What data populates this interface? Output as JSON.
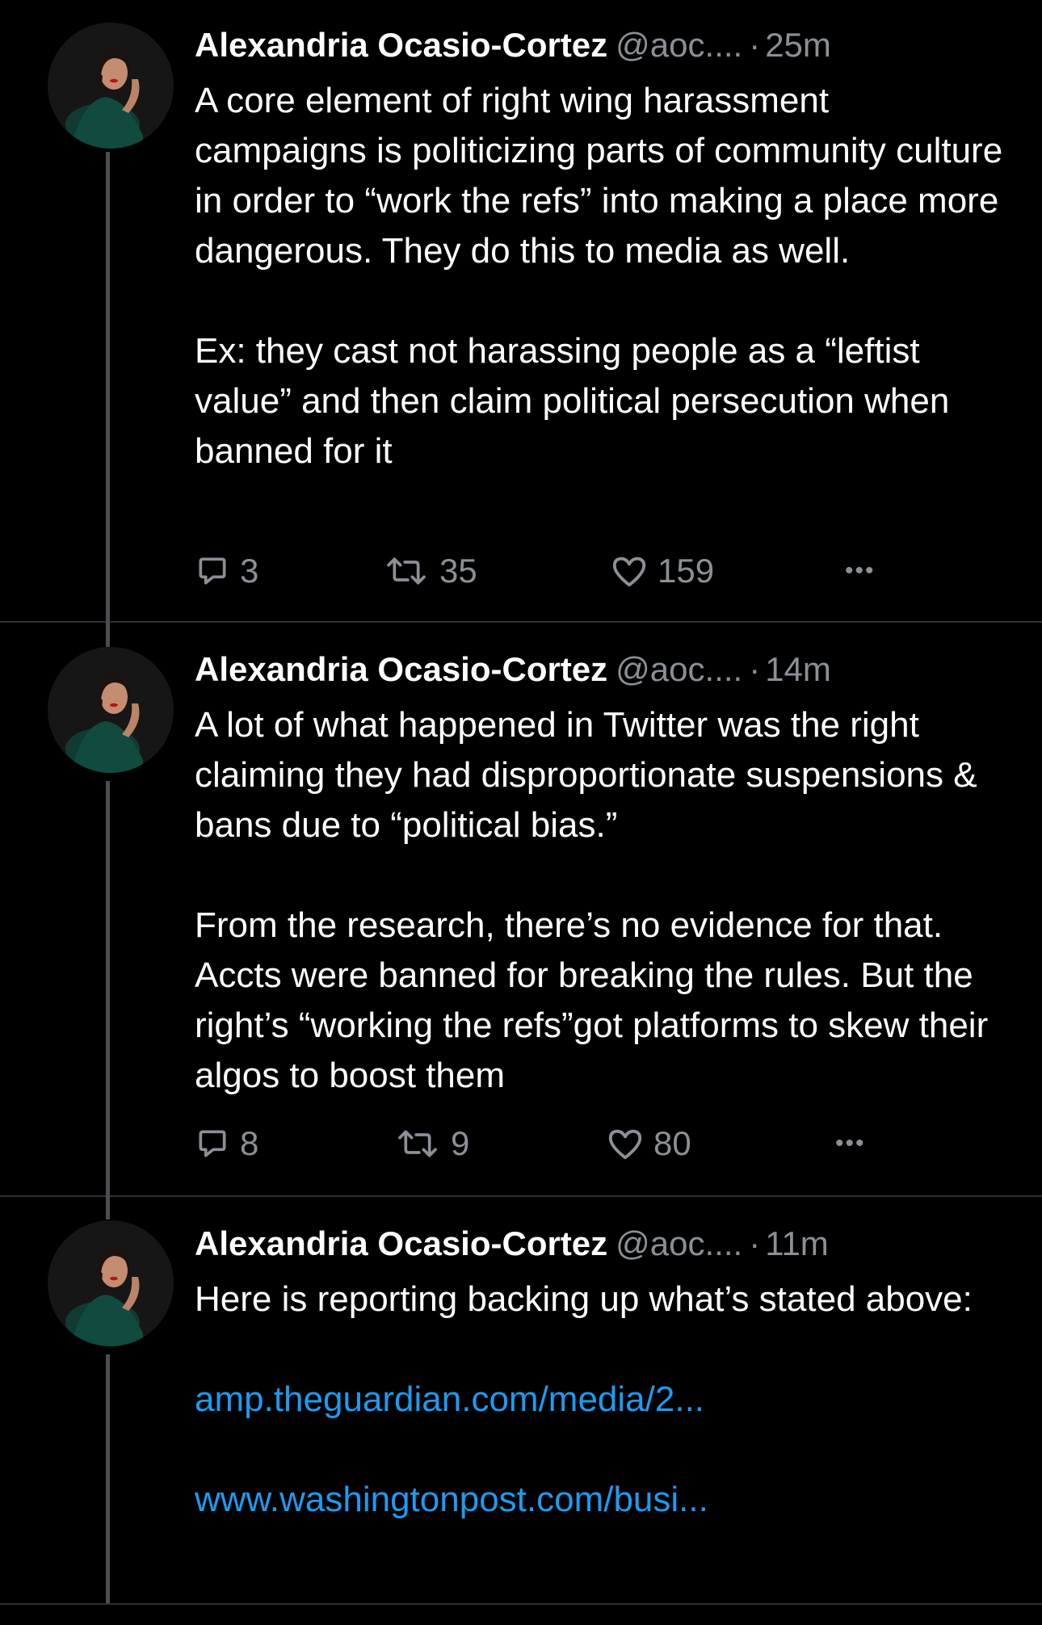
{
  "thread": [
    {
      "author_name": "Alexandria Ocasio-Cortez",
      "handle": "@aoc....",
      "separator": "·",
      "time": "25m",
      "paragraphs": [
        "A core element of right wing harassment campaigns is politicizing parts of community culture in order to “work the refs” into making a place more dangerous. They do this to media as well.",
        "Ex: they cast not harassing people as a “leftist value” and then claim political persecution when banned for it"
      ],
      "replies": "3",
      "retweets": "35",
      "likes": "159",
      "more": "•••"
    },
    {
      "author_name": "Alexandria Ocasio-Cortez",
      "handle": "@aoc....",
      "separator": "·",
      "time": "14m",
      "paragraphs": [
        "A lot of what happened in Twitter was the right claiming they had disproportionate suspensions & bans due to “political bias.”",
        "From the research, there’s no evidence for that. Accts were banned for breaking the rules. But the right’s “working the refs”got platforms to skew their algos to boost them"
      ],
      "replies": "8",
      "retweets": "9",
      "likes": "80",
      "more": "•••"
    },
    {
      "author_name": "Alexandria Ocasio-Cortez",
      "handle": "@aoc....",
      "separator": "·",
      "time": "11m",
      "paragraphs": [
        "Here is reporting backing up what’s stated above:"
      ],
      "links": [
        "amp.theguardian.com/media/2...",
        "www.washingtonpost.com/busi..."
      ]
    }
  ],
  "colors": {
    "background": "#000000",
    "text": "#ffffff",
    "secondary_text": "#8b9096",
    "link": "#1d9bf0",
    "divider": "#2f3336",
    "thread_line": "#4a4e52"
  },
  "icons": [
    "reply-icon",
    "retweet-icon",
    "like-icon",
    "more-icon"
  ]
}
